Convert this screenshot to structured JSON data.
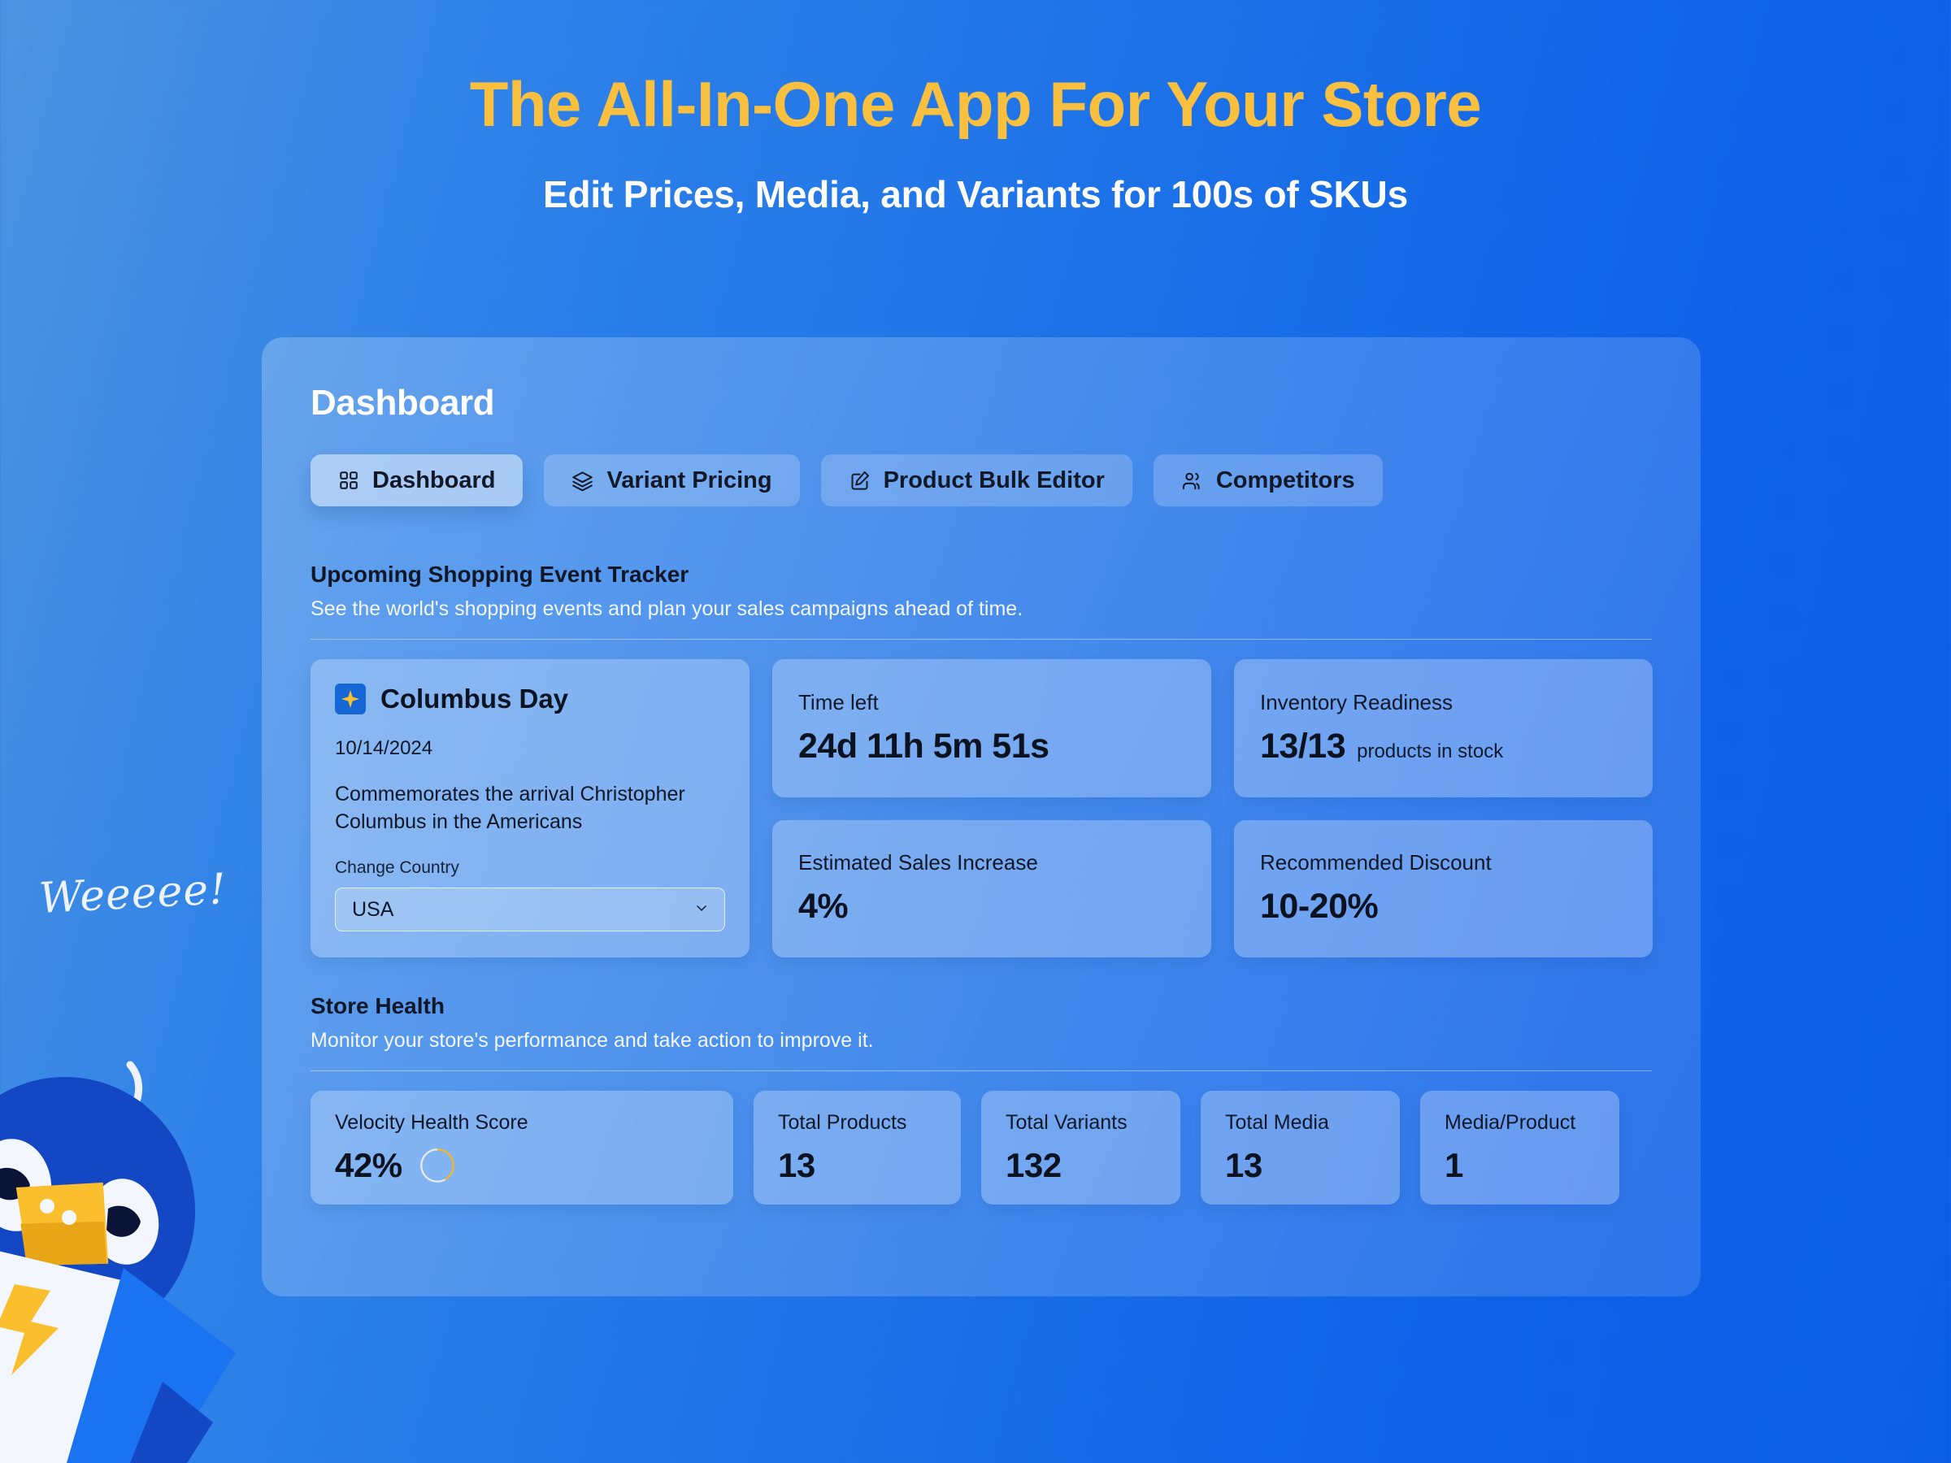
{
  "hero": {
    "title": "The All-In-One App For Your Store",
    "subtitle": "Edit Prices, Media, and Variants for 100s of SKUs",
    "title_color": "#f9bf3f",
    "subtitle_color": "#ffffff"
  },
  "panel": {
    "title": "Dashboard"
  },
  "tabs": [
    {
      "label": "Dashboard",
      "icon": "grid-icon",
      "active": true
    },
    {
      "label": "Variant Pricing",
      "icon": "layers-icon",
      "active": false
    },
    {
      "label": "Product Bulk Editor",
      "icon": "edit-square-icon",
      "active": false
    },
    {
      "label": "Competitors",
      "icon": "users-icon",
      "active": false
    }
  ],
  "event_section": {
    "title": "Upcoming Shopping Event Tracker",
    "subtitle": "See the world's shopping events and plan your sales campaigns ahead of time."
  },
  "event": {
    "flag_icon": "sparkle-flag-icon",
    "name": "Columbus Day",
    "date": "10/14/2024",
    "description": "Commemorates the arrival Christopher Columbus in the Americans",
    "country_label": "Change Country",
    "country_value": "USA",
    "country_chevron": "chevron-down-icon"
  },
  "event_stats": [
    {
      "label": "Time left",
      "value": "24d 11h 5m 51s",
      "suffix": ""
    },
    {
      "label": "Inventory Readiness",
      "value": "13/13",
      "suffix": "products in stock"
    },
    {
      "label": "Estimated Sales Increase",
      "value": "4%",
      "suffix": ""
    },
    {
      "label": "Recommended Discount",
      "value": "10-20%",
      "suffix": ""
    }
  ],
  "health_section": {
    "title": "Store Health",
    "subtitle": "Monitor your store's performance and take action to improve it."
  },
  "health_stats": [
    {
      "label": "Velocity Health Score",
      "value": "42%",
      "progress": 42,
      "progress_color": "#f5b728",
      "track_color": "#e8eaf0"
    },
    {
      "label": "Total Products",
      "value": "13"
    },
    {
      "label": "Total Variants",
      "value": "132"
    },
    {
      "label": "Total Media",
      "value": "13"
    },
    {
      "label": "Media/Product",
      "value": "1"
    }
  ],
  "mascot": {
    "speech": "Weeeee!",
    "body_color": "#1447c4",
    "belly_color": "#f3f6fd",
    "beak_color": "#fbbe2c",
    "accent_color": "#1a73f0"
  }
}
